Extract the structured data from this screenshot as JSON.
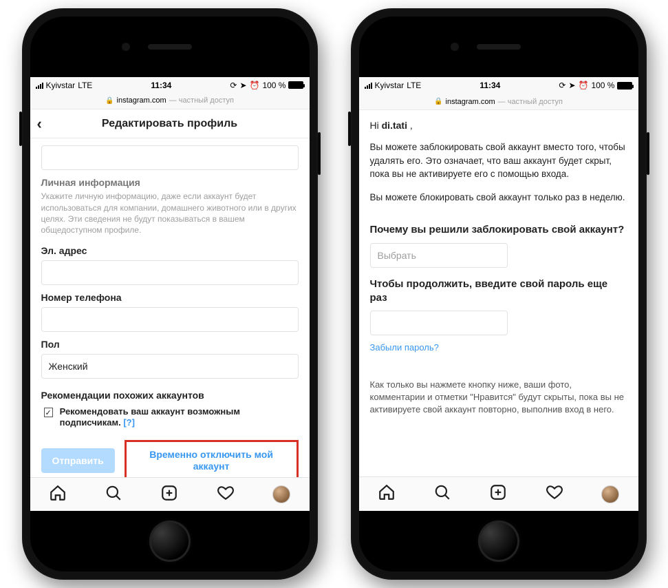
{
  "status_bar": {
    "carrier": "Kyivstar",
    "network": "LTE",
    "time": "11:34",
    "battery_text": "100 %",
    "icons": [
      "orientation-lock-icon",
      "location-icon",
      "alarm-icon"
    ]
  },
  "url_bar": {
    "lock": "🔒",
    "domain": "instagram.com",
    "suffix": "— частный доступ"
  },
  "tab_bar": {
    "items": [
      "home-icon",
      "search-icon",
      "add-post-icon",
      "activity-icon",
      "profile-avatar"
    ]
  },
  "screen1": {
    "header_title": "Редактировать профиль",
    "personal_info": {
      "title": "Личная информация",
      "desc": "Укажите личную информацию, даже если аккаунт будет использоваться для компании, домашнего животного или в других целях. Эти сведения не будут показываться в вашем общедоступном профиле."
    },
    "fields": {
      "email_label": "Эл. адрес",
      "email_value": "",
      "phone_label": "Номер телефона",
      "phone_value": "",
      "gender_label": "Пол",
      "gender_value": "Женский"
    },
    "recommendations": {
      "title": "Рекомендации похожих аккаунтов",
      "checkbox_text": "Рекомендовать ваш аккаунт возможным подписчикам.",
      "help": "[?]",
      "checked": true
    },
    "actions": {
      "submit": "Отправить",
      "disable_link": "Временно отключить мой аккаунт"
    }
  },
  "screen2": {
    "greeting_prefix": "Hi ",
    "greeting_name": "di.tati",
    "greeting_suffix": " ,",
    "para1": "Вы можете заблокировать свой аккаунт вместо того, чтобы удалять его. Это означает, что ваш аккаунт будет скрыт, пока вы не активируете его с помощью входа.",
    "para2": "Вы можете блокировать свой аккаунт только раз в неделю.",
    "reason_label": "Почему вы решили заблокировать свой аккаунт?",
    "reason_placeholder": "Выбрать",
    "password_label": "Чтобы продолжить, введите свой пароль еще раз",
    "forgot_password": "Забыли пароль?",
    "footer": "Как только вы нажмете кнопку ниже, ваши фото, комментарии и отметки \"Нравится\" будут скрыты, пока вы не активируете свой аккаунт повторно, выполнив вход в него."
  }
}
